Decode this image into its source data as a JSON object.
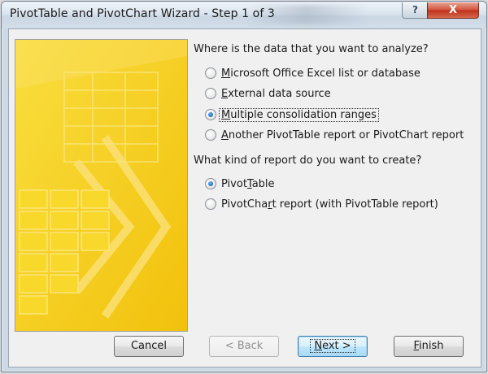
{
  "window": {
    "title": "PivotTable and PivotChart Wizard - Step 1 of 3",
    "help_glyph": "?",
    "close_glyph": "X"
  },
  "data_source": {
    "question": "Where is the data that you want to analyze?",
    "options": [
      {
        "pre": "",
        "key": "M",
        "post": "icrosoft Office Excel list or database",
        "selected": false
      },
      {
        "pre": "",
        "key": "E",
        "post": "xternal data source",
        "selected": false
      },
      {
        "pre": "",
        "key": "M",
        "post": "ultiple consolidation ranges",
        "selected": true
      },
      {
        "pre": "",
        "key": "A",
        "post": "nother PivotTable report or PivotChart report",
        "selected": false
      }
    ]
  },
  "report_type": {
    "question": "What kind of report do you want to create?",
    "options": [
      {
        "pre": "Pivot",
        "key": "T",
        "post": "able",
        "selected": true
      },
      {
        "pre": "PivotCha",
        "key": "r",
        "post": "t report (with PivotTable report)",
        "selected": false
      }
    ]
  },
  "buttons": {
    "cancel": "Cancel",
    "back": "< Back",
    "next_key": "N",
    "next_rest": "ext >",
    "finish_key": "F",
    "finish_rest": "inish"
  },
  "colors": {
    "banner_yellow": "#f7d21c",
    "radio_selected": "#1f6fc3",
    "close_red": "#c0301a"
  }
}
